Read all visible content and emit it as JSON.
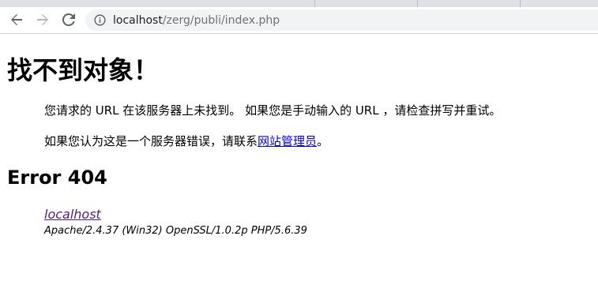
{
  "browser": {
    "url_host": "localhost",
    "url_path": "/zerg/publi/index.php",
    "icons": {
      "back": "arrow-left-icon",
      "forward": "arrow-right-icon",
      "reload": "reload-icon",
      "info": "info-icon"
    }
  },
  "page": {
    "title": "找不到对象！",
    "message_line1": "您请求的 URL 在该服务器上未找到。 如果您是手动输入的 URL ，请检查拼写并重试。",
    "message_line2_prefix": "如果您认为这是一个服务器错误，请联系",
    "webmaster_link": "网站管理员",
    "message_line2_suffix": "。",
    "error_heading": "Error 404",
    "host_link": "localhost",
    "server_signature": "Apache/2.4.37 (Win32) OpenSSL/1.0.2p PHP/5.6.39"
  },
  "colors": {
    "link": "#0000ee",
    "visited_link": "#551a8b",
    "omnibox_bg": "#f1f3f4",
    "tabstrip_bg": "#dee1e6"
  }
}
